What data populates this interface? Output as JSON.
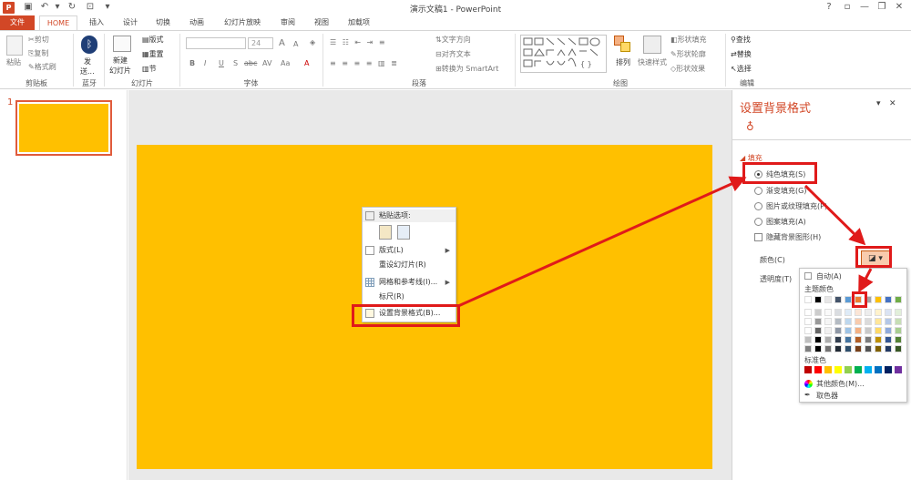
{
  "titlebar": {
    "title": "演示文稿1 - PowerPoint",
    "app_icon": "P",
    "help": "?",
    "minimize": "—",
    "restore": "❐",
    "close": "✕"
  },
  "tabs": [
    {
      "label": "文件"
    },
    {
      "label": "HOME"
    },
    {
      "label": "插入"
    },
    {
      "label": "设计"
    },
    {
      "label": "切换"
    },
    {
      "label": "动画"
    },
    {
      "label": "幻灯片放映"
    },
    {
      "label": "审阅"
    },
    {
      "label": "视图"
    },
    {
      "label": "加载项"
    }
  ],
  "ribbon": {
    "clipboard": {
      "paste": "粘贴",
      "cut": "剪切",
      "copy": "复制",
      "format_painter": "格式刷",
      "group": "剪贴板"
    },
    "bluetooth": {
      "send": "发",
      "send2": "送...",
      "group": "蓝牙"
    },
    "slides": {
      "new_slide": "新建",
      "new_slide2": "幻灯片",
      "layout": "版式",
      "reset": "重置",
      "section": "节",
      "group": "幻灯片"
    },
    "font": {
      "size": "24",
      "group": "字体",
      "bold": "B",
      "italic": "I",
      "underline": "U",
      "shadow": "S",
      "strike": "abc",
      "spacing": "AV",
      "case": "Aa",
      "grow": "A",
      "shrink": "A"
    },
    "paragraph": {
      "text_direction": "文字方向",
      "align_text": "对齐文本",
      "smartart": "转换为 SmartArt",
      "group": "段落"
    },
    "drawing": {
      "arrange": "排列",
      "quick_styles": "快速样式",
      "shape_fill": "形状填充",
      "shape_outline": "形状轮廓",
      "shape_effects": "形状效果",
      "group": "绘图"
    },
    "editing": {
      "find": "查找",
      "replace": "替换",
      "select": "选择",
      "group": "编辑"
    }
  },
  "thumbnail": {
    "number": "1"
  },
  "context_menu": {
    "paste_options": "粘贴选项:",
    "items": [
      {
        "label": "版式(L)",
        "submenu": true
      },
      {
        "label": "重设幻灯片(R)",
        "submenu": false
      },
      {
        "label": "网格和参考线(I)...",
        "submenu": true
      },
      {
        "label": "标尺(R)",
        "submenu": false
      },
      {
        "label": "设置背景格式(B)...",
        "submenu": false
      }
    ]
  },
  "format_pane": {
    "title": "设置背景格式",
    "close": "✕",
    "dropdown": "▾",
    "section": "填充",
    "options": [
      {
        "label": "纯色填充(S)",
        "selected": true
      },
      {
        "label": "渐变填充(G)",
        "selected": false
      },
      {
        "label": "图片或纹理填充(P)",
        "selected": false
      },
      {
        "label": "图案填充(A)",
        "selected": false
      }
    ],
    "hide_bg": "隐藏背景图形(H)",
    "color_label": "颜色(C)",
    "transparency_label": "透明度(T)"
  },
  "color_popup": {
    "auto": "自动(A)",
    "theme_colors": "主题颜色",
    "standard_colors": "标准色",
    "more_colors": "其他颜色(M)...",
    "eyedropper": "取色器",
    "theme_row": [
      "#ffffff",
      "#000000",
      "#e7e6e6",
      "#44546a",
      "#5b9bd5",
      "#ed7d31",
      "#a5a5a5",
      "#ffc000",
      "#4472c4",
      "#70ad47"
    ],
    "standard_row": [
      "#c00000",
      "#ff0000",
      "#ffc000",
      "#ffff00",
      "#92d050",
      "#00b050",
      "#00b0f0",
      "#0070c0",
      "#002060",
      "#7030a0"
    ]
  },
  "colors": {
    "accent": "#d24726",
    "slide_fill": "#ffc000",
    "annotation": "#e01a1a"
  }
}
